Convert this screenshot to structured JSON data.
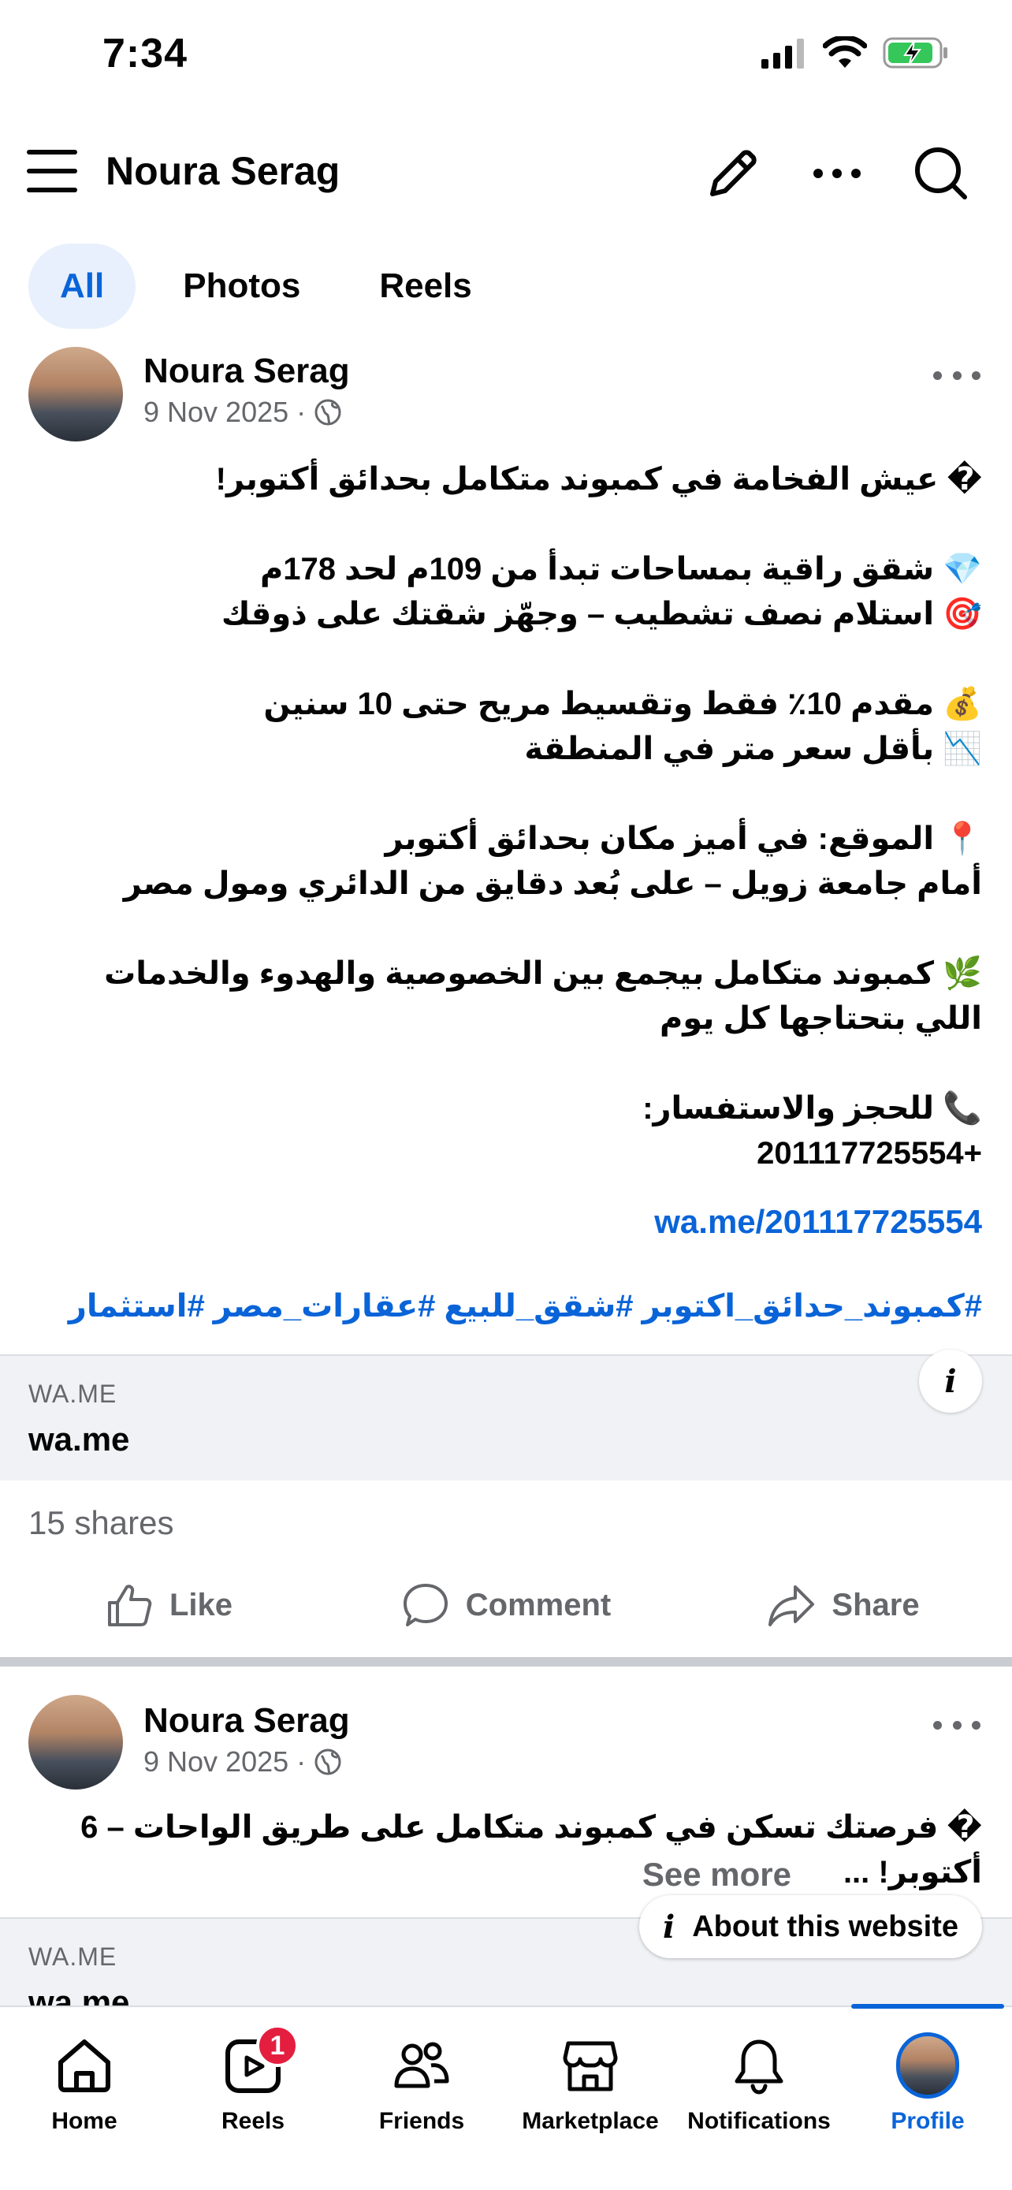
{
  "status_bar": {
    "time": "7:34"
  },
  "header": {
    "title": "Noura Serag"
  },
  "tabs": [
    {
      "label": "All",
      "active": true
    },
    {
      "label": "Photos",
      "active": false
    },
    {
      "label": "Reels",
      "active": false
    }
  ],
  "posts": [
    {
      "author": "Noura Serag",
      "date": "9 Nov 2025",
      "audience_icon": "globe-icon",
      "body": "� عيش الفخامة في كمبوند متكامل بحدائق أكتوبر!\n\n💎 شقق راقية بمساحات تبدأ من 109م لحد 178م\n🎯 استلام نصف تشطيب – وجهّز شقتك على ذوقك\n\n💰 مقدم 10٪ فقط وتقسيط مريح حتى 10 سنين\n📉 بأقل سعر متر في المنطقة\n\n📍 الموقع: في أميز مكان بحدائق أكتوبر\nأمام جامعة زويل – على بُعد دقايق من الدائري ومول مصر\n\n🌿 كمبوند متكامل بيجمع بين الخصوصية والهدوء والخدمات\nاللي بتحتاجها كل يوم\n\n📞 للحجز والاستفسار:\n+201117725554",
      "link": "wa.me/201117725554",
      "hashtags": "#كمبوند_حدائق_اكتوبر #شقق_للبيع #عقارات_مصر #استثمار",
      "link_card": {
        "domain": "WA.ME",
        "title": "wa.me"
      },
      "shares": "15 shares",
      "actions": {
        "like": "Like",
        "comment": "Comment",
        "share": "Share"
      }
    },
    {
      "author": "Noura Serag",
      "date": "9 Nov 2025",
      "audience_icon": "globe-icon",
      "body": "� فرصتك تسكن في كمبوند متكامل على طريق الواحات – 6\nأكتوبر! ...",
      "see_more": "See more",
      "about_website": "About this website",
      "link_card": {
        "domain": "WA.ME",
        "title": "wa.me"
      }
    }
  ],
  "bottom_nav": [
    {
      "label": "Home",
      "icon": "home-icon"
    },
    {
      "label": "Reels",
      "icon": "reels-icon",
      "badge": "1"
    },
    {
      "label": "Friends",
      "icon": "friends-icon"
    },
    {
      "label": "Marketplace",
      "icon": "marketplace-icon"
    },
    {
      "label": "Notifications",
      "icon": "bell-icon"
    },
    {
      "label": "Profile",
      "icon": "profile-avatar",
      "active": true
    }
  ],
  "colors": {
    "accent": "#0a64d8",
    "badge": "#e41e3f",
    "muted": "#65676b",
    "card_bg": "#f0f2f5"
  }
}
